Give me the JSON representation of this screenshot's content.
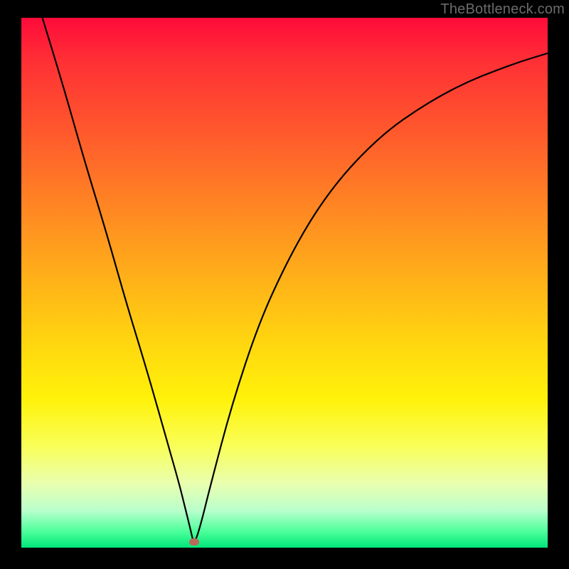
{
  "watermark": {
    "text": "TheBottleneck.com"
  },
  "marker": {
    "x_pct": 32.8,
    "y_pct": 98.9
  },
  "chart_data": {
    "type": "line",
    "title": "",
    "xlabel": "",
    "ylabel": "",
    "xlim": [
      0,
      100
    ],
    "ylim": [
      0,
      100
    ],
    "series": [
      {
        "name": "bottleneck-curve",
        "x": [
          4,
          8,
          12,
          16,
          20,
          24,
          28,
          30,
          31,
          32,
          32.8,
          34,
          36,
          40,
          45,
          50,
          55,
          60,
          65,
          70,
          75,
          80,
          85,
          90,
          95,
          100
        ],
        "y": [
          100,
          87,
          73,
          60,
          46,
          33,
          19,
          12,
          8,
          4,
          0.5,
          4,
          12,
          27,
          42,
          53,
          62,
          69,
          74.5,
          79,
          82.5,
          85.5,
          88,
          90,
          91.8,
          93.3
        ]
      }
    ],
    "annotations": [
      {
        "name": "optimal-point",
        "x": 32.8,
        "y": 0.5
      }
    ],
    "background_gradient": {
      "orientation": "vertical",
      "stops": [
        {
          "pct": 0,
          "color": "#ff0b3a"
        },
        {
          "pct": 50,
          "color": "#ffb318"
        },
        {
          "pct": 72,
          "color": "#fff20a"
        },
        {
          "pct": 100,
          "color": "#00e67a"
        }
      ]
    }
  }
}
